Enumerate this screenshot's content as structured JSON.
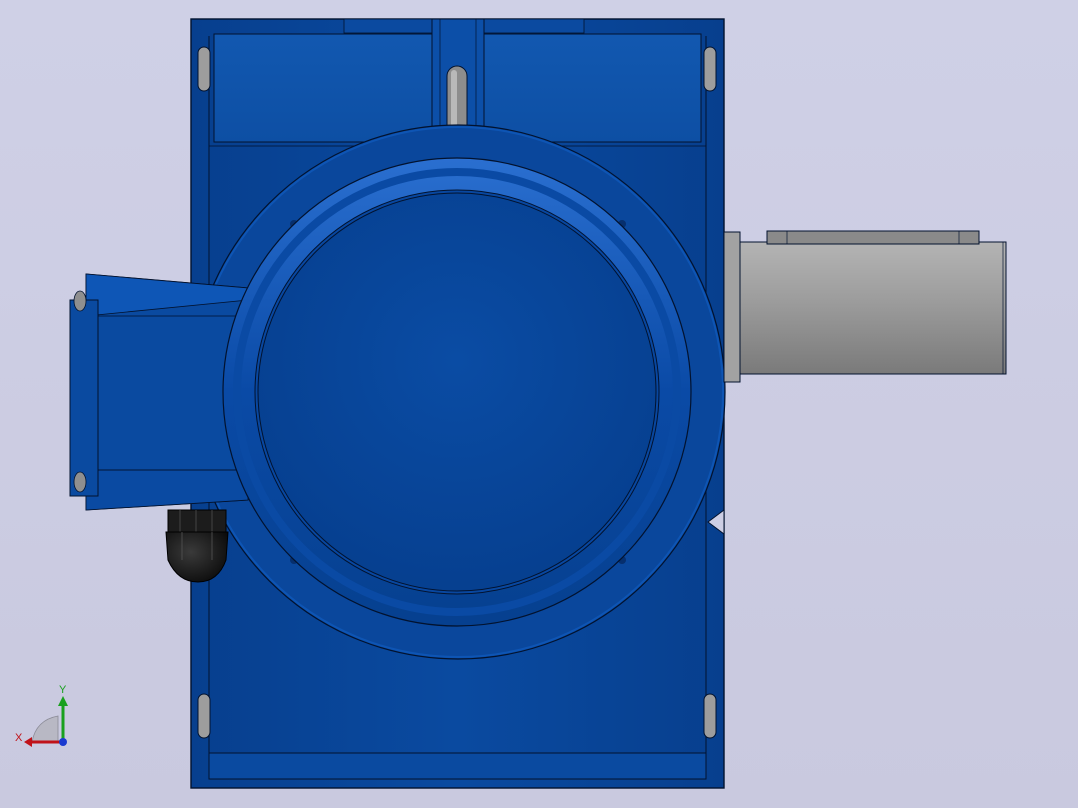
{
  "viewport": {
    "background": "#cdcee4"
  },
  "model": {
    "body_color": "#0a4a9e",
    "body_dark": "#053a86",
    "edge_color": "#02122e",
    "shaft_color": "#9a9a9a",
    "shaft_dark": "#6e6e6e"
  },
  "triad": {
    "x_label": "X",
    "y_label": "Y",
    "x_color": "#c0121a",
    "y_color": "#19a01e",
    "z_color": "#1a3ad0"
  }
}
